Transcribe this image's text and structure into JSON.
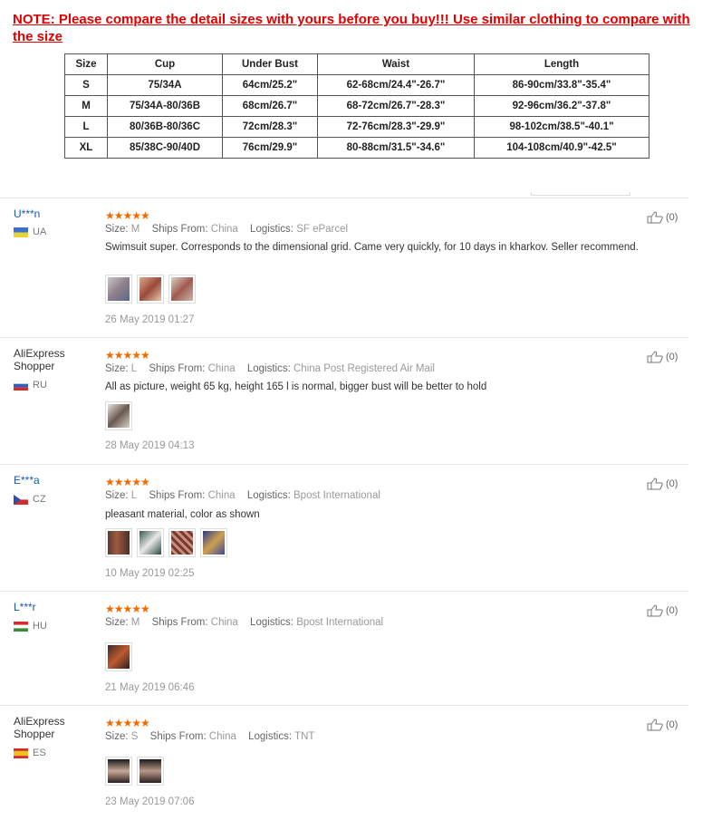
{
  "note": "NOTE: Please compare the detail sizes with yours before you buy!!! Use similar clothing to compare with the size",
  "size_table": {
    "headers": [
      "Size",
      "Cup",
      "Under Bust",
      "Waist",
      "Length"
    ],
    "rows": [
      [
        "S",
        "75/34A",
        "64cm/25.2\"",
        "62-68cm/24.4\"-26.7\"",
        "86-90cm/33.8\"-35.4\""
      ],
      [
        "M",
        "75/34A-80/36B",
        "68cm/26.7\"",
        "68-72cm/26.7\"-28.3\"",
        "92-96cm/36.2\"-37.8\""
      ],
      [
        "L",
        "80/36B-80/36C",
        "72cm/28.3\"",
        "72-76cm/28.3\"-29.9\"",
        "98-102cm/38.5\"-40.1\""
      ],
      [
        "XL",
        "85/38C-90/40D",
        "76cm/29.9\"",
        "80-88cm/31.5\"-34.6\"",
        "104-108cm/40.9\"-42.5\""
      ]
    ]
  },
  "labels": {
    "size": "Size:",
    "ships_from": "Ships From:",
    "logistics": "Logistics:"
  },
  "reviews": [
    {
      "user": "U***n",
      "country": "UA",
      "stars": "★★★★★",
      "size": "M",
      "ships_from": "China",
      "logistics": "SF eParcel",
      "text": "Swimsuit super. Corresponds to the dimensional grid. Came very quickly, for 10 days in kharkov. Seller recommend.",
      "date": "26 May 2019 01:27",
      "likes": "(0)"
    },
    {
      "user": "AliExpress Shopper",
      "country": "RU",
      "stars": "★★★★★",
      "size": "L",
      "ships_from": "China",
      "logistics": "China Post Registered Air Mail",
      "text": "All as picture, weight 65 kg, height 165 l is normal, bigger bust will be better to hold",
      "date": "28 May 2019 04:13",
      "likes": "(0)"
    },
    {
      "user": "E***a",
      "country": "CZ",
      "stars": "★★★★★",
      "size": "L",
      "ships_from": "China",
      "logistics": "Bpost International",
      "text": "pleasant material, color as shown",
      "date": "10 May 2019 02:25",
      "likes": "(0)"
    },
    {
      "user": "L***r",
      "country": "HU",
      "stars": "★★★★★",
      "size": "M",
      "ships_from": "China",
      "logistics": "Bpost International",
      "text": "",
      "date": "21 May 2019 06:46",
      "likes": "(0)"
    },
    {
      "user": "AliExpress Shopper",
      "country": "ES",
      "stars": "★★★★★",
      "size": "S",
      "ships_from": "China",
      "logistics": "TNT",
      "text": "",
      "date": "23 May 2019 07:06",
      "likes": "(0)"
    }
  ],
  "colors": {
    "note_red": "#e00000",
    "username_blue": "#1a56a8",
    "star_orange": "#f26b00"
  }
}
